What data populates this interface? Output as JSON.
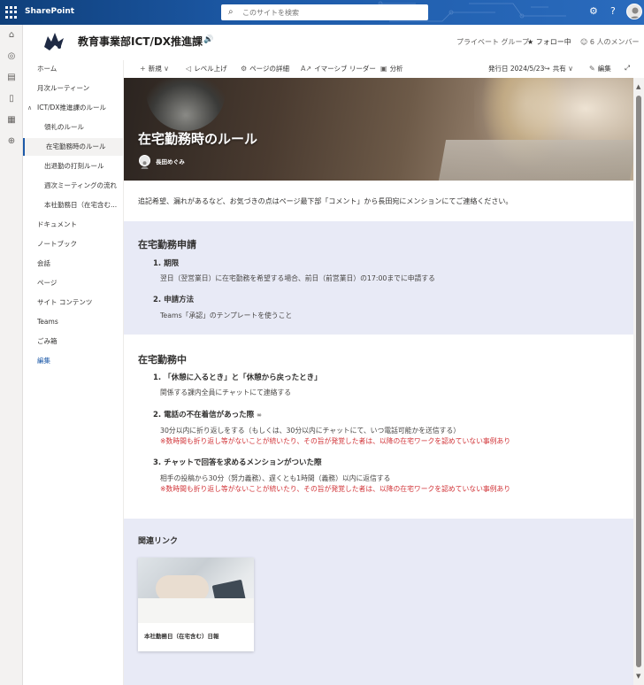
{
  "suite": {
    "brand": "SharePoint",
    "search_placeholder": "このサイトを検索",
    "icons": [
      "waffle-icon",
      "settings-icon",
      "help-icon",
      "avatar"
    ]
  },
  "site": {
    "title": "教育事業部ICT/DX推進課",
    "privacy": "プライベート グループ",
    "follow": "フォロー中",
    "members": "6 人のメンバー"
  },
  "nav": {
    "items": [
      {
        "label": "ホーム"
      },
      {
        "label": "月次ルーティーン"
      },
      {
        "label": "ICT/DX推進課のルール",
        "expanded": true
      },
      {
        "label": "領礼のルール",
        "sub": true
      },
      {
        "label": "在宅勤務時のルール",
        "sub": true,
        "selected": true
      },
      {
        "label": "出退勤の打刻ルール",
        "sub": true
      },
      {
        "label": "週次ミーティングの流れ",
        "sub": true
      },
      {
        "label": "本社勤務日（在宅含む...",
        "sub": true
      },
      {
        "label": "ドキュメント"
      },
      {
        "label": "ノートブック"
      },
      {
        "label": "会話"
      },
      {
        "label": "ページ"
      },
      {
        "label": "サイト コンテンツ"
      },
      {
        "label": "Teams"
      },
      {
        "label": "ごみ箱"
      },
      {
        "label": "編集",
        "edit": true
      }
    ]
  },
  "commands": {
    "new": "新規",
    "promote": "レベル上げ",
    "page_details": "ページの詳細",
    "immersive": "イマーシブ リーダー",
    "analytics": "分析",
    "published": "発行日 2024/5/23",
    "share": "共有",
    "edit": "編集"
  },
  "page": {
    "title": "在宅勤務時のルール",
    "author": "長田めぐみ",
    "intro": "追記希望、漏れがあるなど、お気づきの点はページ最下部「コメント」から長田宛にメンションにてご連絡ください。",
    "section1": {
      "title": "在宅勤務申請",
      "items": [
        {
          "num": "1.",
          "head": "期限",
          "body": "翌日（翌営業日）に在宅勤務を希望する場合、前日（前営業日）の17:00までに申請する"
        },
        {
          "num": "2.",
          "head": "申請方法",
          "body": "Teams「承認」のテンプレートを使うこと"
        }
      ]
    },
    "section2": {
      "title": "在宅勤務中",
      "items": [
        {
          "num": "1.",
          "head": "「休憩に入るとき」と「休憩から戻ったとき」",
          "body": "関係する課内全員にチャットにて連絡する"
        },
        {
          "num": "2.",
          "head": "電話の不在着信があった際",
          "body": "30分以内に折り返しをする（もしくは、30分以内にチャットにて、いつ電話可能かを送信する）",
          "warn": "※数時間も折り返し等がないことが続いたり、その旨が発覚した者は、以降の在宅ワークを認めていない事例あり"
        },
        {
          "num": "3.",
          "head": "チャットで回答を求めるメンションがついた際",
          "body": "相手の投稿から30分（努力義務）、遅くとも1時間（義務）以内に返信する",
          "warn": "※数時間も折り返し等がないことが続いたり、その旨が発覚した者は、以降の在宅ワークを認めていない事例あり"
        }
      ]
    },
    "related": {
      "title": "関連リンク",
      "cards": [
        {
          "title": "本社勤務日（在宅含む）日報"
        }
      ]
    }
  },
  "colors": {
    "suite_bar": "#1d5aa8",
    "band": "#e8eaf6",
    "warning": "#d13438",
    "text": "#323130"
  }
}
